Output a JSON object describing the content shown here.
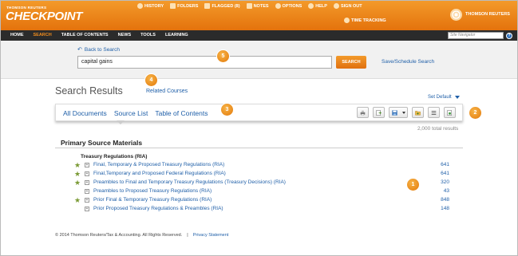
{
  "brand": {
    "top": "THOMSON REUTERS",
    "name": "CHECKPOINT",
    "partner": "THOMSON REUTERS"
  },
  "toplinks": [
    {
      "label": "HISTORY",
      "icon": "history-icon"
    },
    {
      "label": "FOLDERS",
      "icon": "folder-icon"
    },
    {
      "label": "FLAGGED (8)",
      "icon": "flag-icon"
    },
    {
      "label": "NOTES",
      "icon": "notes-icon"
    },
    {
      "label": "OPTIONS",
      "icon": "options-icon"
    },
    {
      "label": "HELP",
      "icon": "help-icon"
    },
    {
      "label": "SIGN OUT",
      "icon": "signout-icon"
    }
  ],
  "time_tracking": "TIME TRACKING",
  "nav": [
    "HOME",
    "SEARCH",
    "TABLE OF CONTENTS",
    "NEWS",
    "TOOLS",
    "LEARNING"
  ],
  "site_navigator": {
    "placeholder": "Site Navigator"
  },
  "search": {
    "back": "Back to Search",
    "query": "capital gains",
    "button": "SEARCH",
    "save": "Save/Schedule Search"
  },
  "results": {
    "title": "Search Results",
    "related": "Related Courses",
    "set_default": "Set Default",
    "tabs": [
      "All Documents",
      "Source List",
      "Table of Contents"
    ],
    "total": "2,000 total results",
    "section": "Primary Source Materials",
    "group": "Treasury Regulations (RIA)",
    "rows": [
      {
        "label": "Final, Temporary & Proposed Treasury Regulations (RIA)",
        "count": "641",
        "starred": true
      },
      {
        "label": "Final,Temporary and Proposed Federal Regulations (RIA)",
        "count": "641",
        "starred": true
      },
      {
        "label": "Preambles to Final and Temporary Treasury Regulations (Treasury Decisions) (RIA)",
        "count": "320",
        "starred": true
      },
      {
        "label": "Preambles to Proposed Treasury Regulations (RIA)",
        "count": "43",
        "starred": false
      },
      {
        "label": "Prior Final & Temporary Treasury Regulations (RIA)",
        "count": "848",
        "starred": true
      },
      {
        "label": "Prior Proposed Treasury Regulations & Preambles (RIA)",
        "count": "148",
        "starred": false
      }
    ]
  },
  "footer": {
    "copyright": "© 2014 Thomson Reuters/Tax & Accounting. All Rights Reserved.",
    "sep": "|",
    "privacy": "Privacy Statement"
  },
  "callouts": [
    "1",
    "2",
    "3",
    "4",
    "5"
  ],
  "colors": {
    "orange": "#e87d12",
    "link": "#1f5fa8",
    "nav": "#2b2b2b",
    "star": "#7a9a34"
  }
}
